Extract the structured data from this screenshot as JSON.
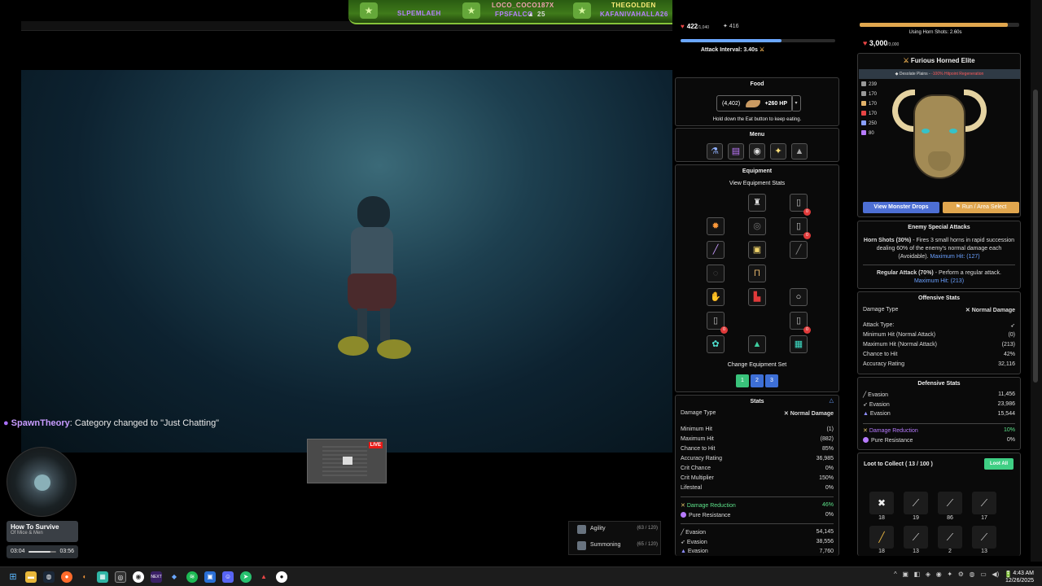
{
  "banner": {
    "left_name": "LOCO_COCO187X",
    "left_sub": "SLPEMLAEH",
    "mid_sub": "FPSFALCO",
    "mid_count": "25",
    "right_name": "THEGOLDEN",
    "right_sub": "KAFANIVAHALLA26"
  },
  "stream": {
    "chat_user": "SpawnTheory",
    "chat_message": ": Category changed to \"Just Chatting\"",
    "live_badge": "LIVE"
  },
  "music": {
    "title": "How To Survive",
    "artist": "Of Mice & Men",
    "current_time": "03:04",
    "duration": "03:56",
    "progress": 0.78
  },
  "skills_mini": [
    {
      "name": "Agility",
      "level": "(63 / 120)"
    },
    {
      "name": "Summoning",
      "level": "(65 / 120)"
    }
  ],
  "player": {
    "hp": "422",
    "hp_max": "/1,040",
    "coins": "416",
    "attack_interval": "Attack Interval: 3.40s",
    "attack_progress": 0.65
  },
  "food": {
    "title": "Food",
    "count": "(4,402)",
    "heal": "+260 HP",
    "dropdown": "▾",
    "hint": "Hold down the Eat button to keep eating."
  },
  "menu": {
    "title": "Menu",
    "icons": [
      "potion-icon",
      "book-icon",
      "orb-icon",
      "sparkle-icon",
      "wolf-icon"
    ]
  },
  "equipment": {
    "title": "Equipment",
    "view_stats": "View Equipment Stats",
    "change_set": "Change Equipment Set",
    "sets": [
      "1",
      "2",
      "3"
    ],
    "badge": "0"
  },
  "stats": {
    "title": "Stats",
    "damage_type_label": "Damage Type",
    "damage_type_value": "Normal Damage",
    "rows": [
      {
        "label": "Minimum Hit",
        "value": "(1)"
      },
      {
        "label": "Maximum Hit",
        "value": "(882)"
      },
      {
        "label": "Chance to Hit",
        "value": "85%"
      },
      {
        "label": "Accuracy Rating",
        "value": "36,985"
      },
      {
        "label": "Crit Chance",
        "value": "0%"
      },
      {
        "label": "Crit Multiplier",
        "value": "150%"
      },
      {
        "label": "Lifesteal",
        "value": "0%"
      }
    ],
    "damage_reduction_label": "Damage Reduction",
    "damage_reduction_value": "46%",
    "pure_resistance_label": "Pure Resistance",
    "pure_resistance_value": "0%",
    "evasion": [
      {
        "label": "Evasion",
        "value": "54,145"
      },
      {
        "label": "Evasion",
        "value": "38,556"
      },
      {
        "label": "Evasion",
        "value": "7,760"
      }
    ]
  },
  "enemy": {
    "horn_shots": "Using Horn Shots: 2.60s",
    "hp": "3,000",
    "hp_max": "/3,000",
    "horn_progress": 0.93,
    "name": "Furious Horned Elite",
    "area": "Desolate Plains",
    "area_effect": "-100% Hitpoint Regeneration",
    "stats": [
      "239",
      "170",
      "170",
      "170",
      "250",
      "80"
    ],
    "drops_button": "View Monster Drops",
    "area_button": "Run / Area Select",
    "special_title": "Enemy Special Attacks",
    "horn_attack_name": "Horn Shots (30%)",
    "horn_attack_desc": " - Fires 3 small horns in rapid succession dealing 60% of the enemy's normal damage each (Avoidable).",
    "horn_max_hit": "Maximum Hit: (127)",
    "regular_attack_name": "Regular Attack (70%)",
    "regular_attack_desc": " - Perform a regular attack.",
    "regular_max_hit": "Maximum Hit: (213)",
    "offensive_title": "Offensive Stats",
    "damage_type_label": "Damage Type",
    "damage_type_value": "Normal Damage",
    "offensive_rows": [
      {
        "label": "Attack Type:",
        "value": ""
      },
      {
        "label": "Minimum Hit (Normal Attack)",
        "value": "(0)"
      },
      {
        "label": "Maximum Hit (Normal Attack)",
        "value": "(213)"
      },
      {
        "label": "Chance to Hit",
        "value": "42%"
      },
      {
        "label": "Accuracy Rating",
        "value": "32,116"
      }
    ],
    "defensive_title": "Defensive Stats",
    "evasion": [
      {
        "label": "Evasion",
        "value": "11,456"
      },
      {
        "label": "Evasion",
        "value": "23,986"
      },
      {
        "label": "Evasion",
        "value": "15,544"
      }
    ],
    "damage_reduction_label": "Damage Reduction",
    "damage_reduction_value": "10%",
    "pure_resistance_label": "Pure Resistance",
    "pure_resistance_value": "0%"
  },
  "loot": {
    "title": "Loot to Collect ( 13 / 100 )",
    "loot_all": "Loot All",
    "counts": [
      "18",
      "19",
      "86",
      "17",
      "18",
      "13",
      "2",
      "13"
    ]
  },
  "taskbar": {
    "time": "4:43 AM",
    "date": "12/26/2025"
  },
  "colors": {
    "accent_blue": "#4d6fd4",
    "accent_green": "#3fcf84",
    "accent_gold": "#e0a64e",
    "hp_red": "#e84545"
  }
}
